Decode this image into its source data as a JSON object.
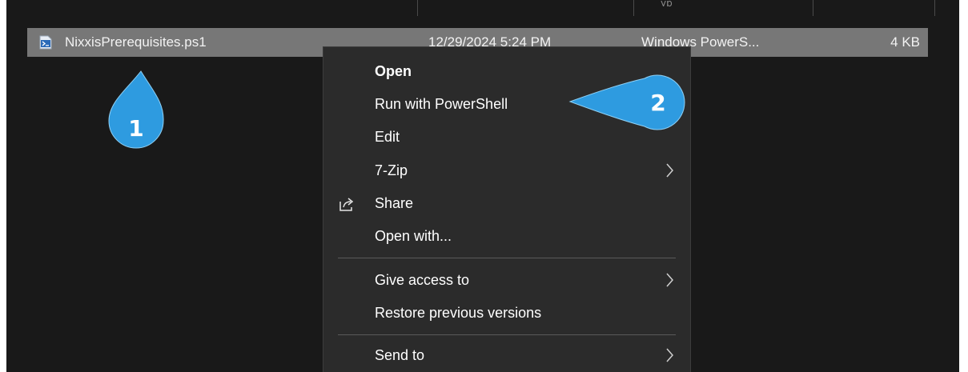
{
  "file_row": {
    "name": "NixxisPrerequisites.ps1",
    "date_modified": "12/29/2024 5:24 PM",
    "type": "Windows PowerS...",
    "size": "4 KB",
    "icon": "powershell-script-icon"
  },
  "header_fragment": "yp",
  "context_menu": {
    "items": [
      {
        "label": "Open",
        "bold": true
      },
      {
        "label": "Run with PowerShell"
      },
      {
        "label": "Edit"
      },
      {
        "label": "7-Zip",
        "submenu": true
      },
      {
        "label": "Share",
        "icon": "share-icon"
      },
      {
        "label": "Open with..."
      },
      {
        "label": "Give access to",
        "submenu": true
      },
      {
        "label": "Restore previous versions"
      },
      {
        "label": "Send to",
        "submenu": true
      }
    ]
  },
  "callouts": [
    {
      "number": "1"
    },
    {
      "number": "2"
    }
  ],
  "colors": {
    "explorer_bg": "#191919",
    "selected_row": "#777777",
    "menu_bg": "#2b2b2b",
    "callout": "#2e9be0"
  }
}
